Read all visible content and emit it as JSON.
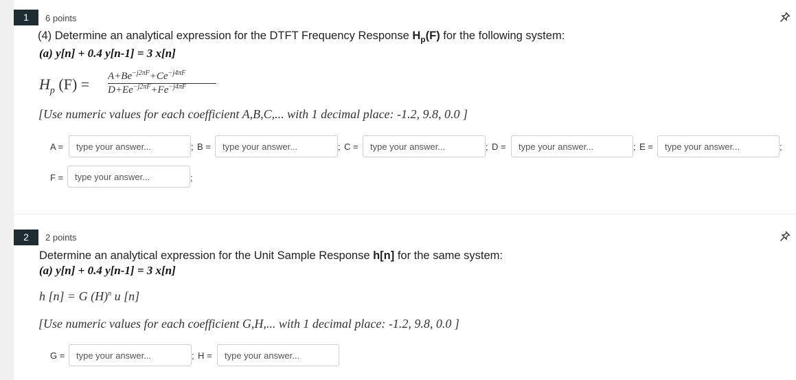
{
  "questions": [
    {
      "number": "1",
      "points": "6 points",
      "prompt_pre": "(4) Determine an analytical expression for the DTFT Frequency Response ",
      "prompt_bold_main": "H",
      "prompt_bold_sub": "p",
      "prompt_bold_after": "(F)",
      "prompt_post": " for the following system:",
      "equation": "(a) y[n] + 0.4 y[n-1]  = 3 x[n]",
      "formula_lhs": "H",
      "formula_lhs_sub": "p",
      "formula_lhs_arg": " (F) =",
      "numerator_A": "A+Be",
      "numerator_exp1": "−j2πF",
      "numerator_C": "+Ce",
      "numerator_exp2": "−j4πF",
      "denominator_D": "D+Ee",
      "denominator_exp1": "−j2πF",
      "denominator_F": "+Fe",
      "denominator_exp2": "−j4πF",
      "note": "[Use numeric values for each coefficient A,B,C,... with 1 decimal place: -1.2, 9.8, 0.0 ]",
      "fields": [
        {
          "label": "A =",
          "placeholder": "type your answer..."
        },
        {
          "label": "B =",
          "placeholder": "type your answer..."
        },
        {
          "label": "C =",
          "placeholder": "type your answer..."
        },
        {
          "label": "D =",
          "placeholder": "type your answer..."
        },
        {
          "label": "E =",
          "placeholder": "type your answer..."
        },
        {
          "label": "F =",
          "placeholder": "type your answer..."
        }
      ]
    },
    {
      "number": "2",
      "points": "2 points",
      "prompt_pre": "Determine an analytical expression for the Unit Sample Response ",
      "prompt_bold": "h[n]",
      "prompt_post": " for the same system:",
      "equation": "(a) y[n] + 0.4 y[n-1]  = 3 x[n]",
      "formula": "h [n] = G (H)",
      "formula_exp": "n",
      "formula_tail": " u [n]",
      "note": "[Use numeric values for each coefficient G,H,... with 1 decimal place: -1.2, 9.8, 0.0 ]",
      "fields": [
        {
          "label": "G =",
          "placeholder": "type your answer..."
        },
        {
          "label": "H =",
          "placeholder": "type your answer..."
        }
      ]
    }
  ],
  "separator": ";",
  "icons": {
    "pin": "pin-icon"
  },
  "colors": {
    "badge_bg": "#1f2d33",
    "badge_text": "#ffffff",
    "leftbar": "#f0f0f0"
  }
}
